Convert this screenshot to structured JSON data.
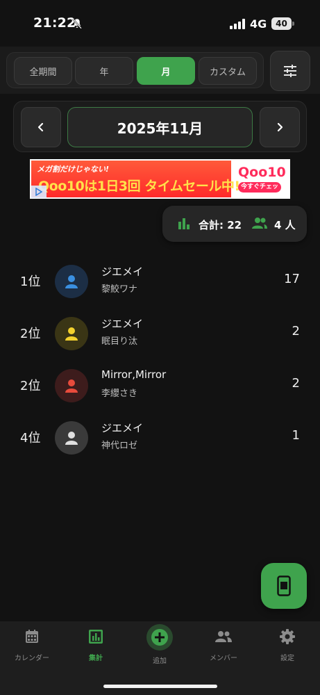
{
  "status": {
    "time": "21:22",
    "network": "4G",
    "battery": "40"
  },
  "period_tabs": [
    {
      "label": "全期間",
      "active": false
    },
    {
      "label": "年",
      "active": false
    },
    {
      "label": "月",
      "active": true
    },
    {
      "label": "カスタム",
      "active": false
    }
  ],
  "filter_icon": "sliders-icon",
  "month": {
    "label": "2025年11月"
  },
  "ad": {
    "tagline": "メガ割だけじゃない!",
    "headline": "Qoo10は1日3回 タイムセール中!",
    "brand": "Qoo10",
    "cta": "今すぐチェック"
  },
  "summary": {
    "total": "合計: 22",
    "people": "4 人"
  },
  "ranking": [
    {
      "rank": "1位",
      "name": "ジエメイ",
      "sub": "黎鮫ワナ",
      "count": "17",
      "bg": "#1c2e45",
      "fg": "#3a8fe0"
    },
    {
      "rank": "2位",
      "name": "ジエメイ",
      "sub": "眠目り汰",
      "count": "2",
      "bg": "#3a3515",
      "fg": "#f2d02e"
    },
    {
      "rank": "2位",
      "name": "Mirror,Mirror",
      "sub": "李纓さき",
      "count": "2",
      "bg": "#3d1c1c",
      "fg": "#e84b3c"
    },
    {
      "rank": "4位",
      "name": "ジエメイ",
      "sub": "神代ロゼ",
      "count": "1",
      "bg": "#3a3a3a",
      "fg": "#e0e0e0"
    }
  ],
  "bottom_nav": [
    {
      "label": "カレンダー",
      "icon": "calendar-icon",
      "active": false
    },
    {
      "label": "集計",
      "icon": "bar-chart-icon",
      "active": true
    },
    {
      "label": "追加",
      "icon": "add-circle-icon",
      "active": false
    },
    {
      "label": "メンバー",
      "icon": "group-icon",
      "active": false
    },
    {
      "label": "設定",
      "icon": "gear-icon",
      "active": false
    }
  ],
  "colors": {
    "accent": "#3fa34d",
    "background": "#121212"
  }
}
